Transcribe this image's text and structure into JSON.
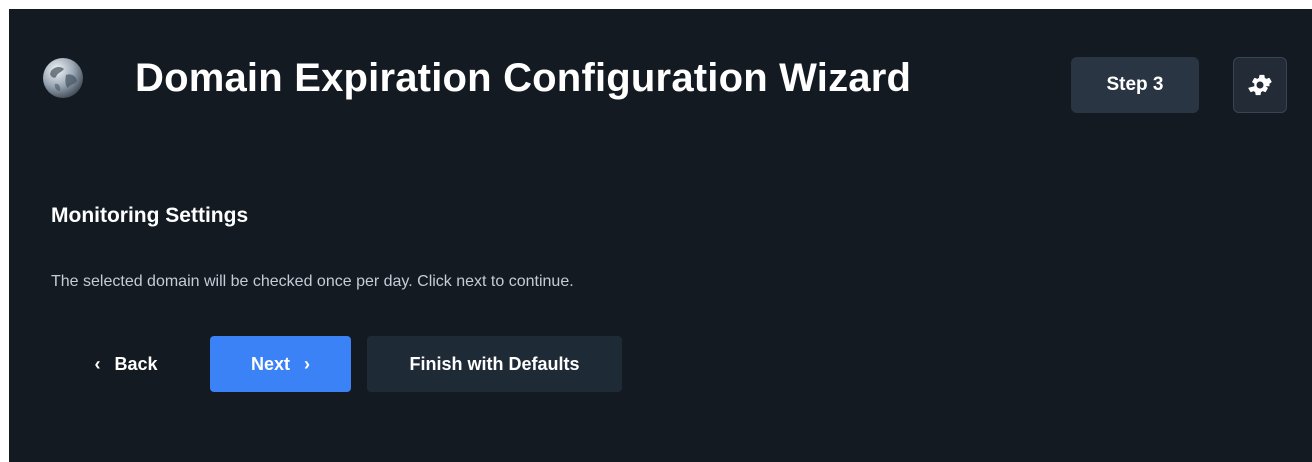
{
  "header": {
    "title": "Domain Expiration Configuration Wizard",
    "step_label": "Step 3",
    "globe_icon": "globe-icon",
    "settings_icon": "gear-icon"
  },
  "section": {
    "title": "Monitoring Settings",
    "description": "The selected domain will be checked once per day. Click next to continue."
  },
  "buttons": {
    "back_label": "Back",
    "back_icon": "chevron-left-icon",
    "next_label": "Next",
    "next_icon": "chevron-right-icon",
    "finish_label": "Finish with Defaults"
  },
  "colors": {
    "background": "#141a22",
    "primary": "#3b82f6",
    "secondary_button": "#1f2a37",
    "badge": "#2a3544",
    "text": "#ffffff",
    "muted_text": "#c5ccd6"
  }
}
